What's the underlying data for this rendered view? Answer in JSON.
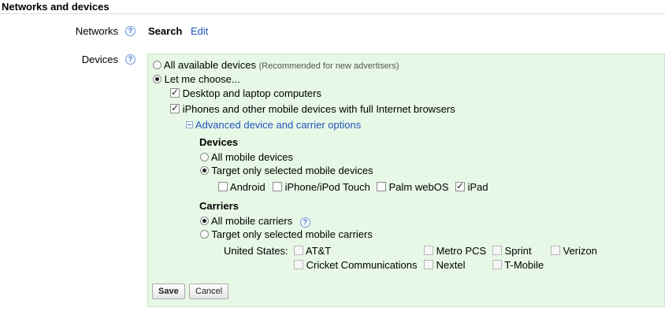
{
  "section": {
    "title": "Networks and devices"
  },
  "networks": {
    "label": "Networks",
    "help": "?",
    "value": "Search",
    "edit_link": "Edit"
  },
  "devices": {
    "label": "Devices",
    "help": "?",
    "options": {
      "all_available": {
        "label": "All available devices",
        "note": "(Recommended for new advertisers)",
        "selected": false
      },
      "let_me_choose": {
        "label": "Let me choose...",
        "selected": true
      }
    },
    "desktop": {
      "label": "Desktop and laptop computers",
      "checked": true
    },
    "mobile": {
      "label": "iPhones and other mobile devices with full Internet browsers",
      "checked": true
    },
    "advanced_link": "Advanced device and carrier options",
    "mobile_devices": {
      "heading": "Devices",
      "all_label": "All mobile devices",
      "target_label": "Target only selected mobile devices",
      "selected_option": "target",
      "items": [
        {
          "label": "Android",
          "checked": false
        },
        {
          "label": "iPhone/iPod Touch",
          "checked": false
        },
        {
          "label": "Palm webOS",
          "checked": false
        },
        {
          "label": "iPad",
          "checked": true
        }
      ]
    },
    "carriers": {
      "heading": "Carriers",
      "all_label": "All mobile carriers",
      "help": "?",
      "target_label": "Target only selected mobile carriers",
      "selected_option": "all",
      "country_label": "United States:",
      "items": [
        {
          "label": "AT&T",
          "checked": false
        },
        {
          "label": "Metro PCS",
          "checked": false
        },
        {
          "label": "Sprint",
          "checked": false
        },
        {
          "label": "Verizon",
          "checked": false
        },
        {
          "label": "Cricket Communications",
          "checked": false
        },
        {
          "label": "Nextel",
          "checked": false
        },
        {
          "label": "T-Mobile",
          "checked": false
        }
      ]
    }
  },
  "buttons": {
    "save": "Save",
    "cancel": "Cancel"
  }
}
